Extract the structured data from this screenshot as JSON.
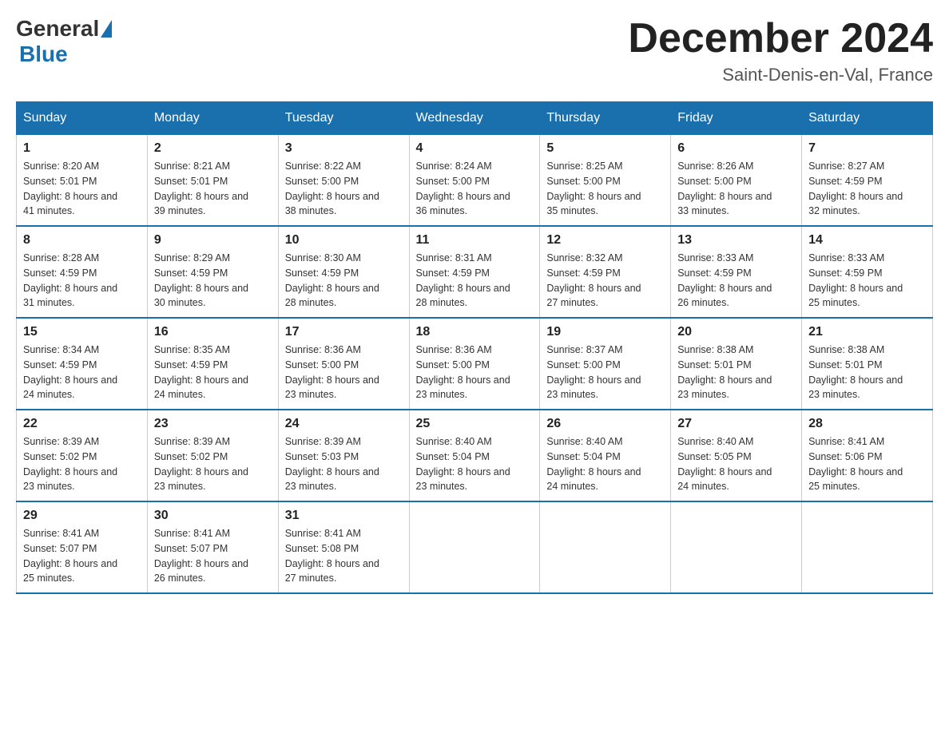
{
  "header": {
    "logo": {
      "text1": "General",
      "text2": "Blue"
    },
    "title": "December 2024",
    "location": "Saint-Denis-en-Val, France"
  },
  "days_of_week": [
    "Sunday",
    "Monday",
    "Tuesday",
    "Wednesday",
    "Thursday",
    "Friday",
    "Saturday"
  ],
  "weeks": [
    [
      {
        "day": "1",
        "sunrise": "8:20 AM",
        "sunset": "5:01 PM",
        "daylight": "8 hours and 41 minutes."
      },
      {
        "day": "2",
        "sunrise": "8:21 AM",
        "sunset": "5:01 PM",
        "daylight": "8 hours and 39 minutes."
      },
      {
        "day": "3",
        "sunrise": "8:22 AM",
        "sunset": "5:00 PM",
        "daylight": "8 hours and 38 minutes."
      },
      {
        "day": "4",
        "sunrise": "8:24 AM",
        "sunset": "5:00 PM",
        "daylight": "8 hours and 36 minutes."
      },
      {
        "day": "5",
        "sunrise": "8:25 AM",
        "sunset": "5:00 PM",
        "daylight": "8 hours and 35 minutes."
      },
      {
        "day": "6",
        "sunrise": "8:26 AM",
        "sunset": "5:00 PM",
        "daylight": "8 hours and 33 minutes."
      },
      {
        "day": "7",
        "sunrise": "8:27 AM",
        "sunset": "4:59 PM",
        "daylight": "8 hours and 32 minutes."
      }
    ],
    [
      {
        "day": "8",
        "sunrise": "8:28 AM",
        "sunset": "4:59 PM",
        "daylight": "8 hours and 31 minutes."
      },
      {
        "day": "9",
        "sunrise": "8:29 AM",
        "sunset": "4:59 PM",
        "daylight": "8 hours and 30 minutes."
      },
      {
        "day": "10",
        "sunrise": "8:30 AM",
        "sunset": "4:59 PM",
        "daylight": "8 hours and 28 minutes."
      },
      {
        "day": "11",
        "sunrise": "8:31 AM",
        "sunset": "4:59 PM",
        "daylight": "8 hours and 28 minutes."
      },
      {
        "day": "12",
        "sunrise": "8:32 AM",
        "sunset": "4:59 PM",
        "daylight": "8 hours and 27 minutes."
      },
      {
        "day": "13",
        "sunrise": "8:33 AM",
        "sunset": "4:59 PM",
        "daylight": "8 hours and 26 minutes."
      },
      {
        "day": "14",
        "sunrise": "8:33 AM",
        "sunset": "4:59 PM",
        "daylight": "8 hours and 25 minutes."
      }
    ],
    [
      {
        "day": "15",
        "sunrise": "8:34 AM",
        "sunset": "4:59 PM",
        "daylight": "8 hours and 24 minutes."
      },
      {
        "day": "16",
        "sunrise": "8:35 AM",
        "sunset": "4:59 PM",
        "daylight": "8 hours and 24 minutes."
      },
      {
        "day": "17",
        "sunrise": "8:36 AM",
        "sunset": "5:00 PM",
        "daylight": "8 hours and 23 minutes."
      },
      {
        "day": "18",
        "sunrise": "8:36 AM",
        "sunset": "5:00 PM",
        "daylight": "8 hours and 23 minutes."
      },
      {
        "day": "19",
        "sunrise": "8:37 AM",
        "sunset": "5:00 PM",
        "daylight": "8 hours and 23 minutes."
      },
      {
        "day": "20",
        "sunrise": "8:38 AM",
        "sunset": "5:01 PM",
        "daylight": "8 hours and 23 minutes."
      },
      {
        "day": "21",
        "sunrise": "8:38 AM",
        "sunset": "5:01 PM",
        "daylight": "8 hours and 23 minutes."
      }
    ],
    [
      {
        "day": "22",
        "sunrise": "8:39 AM",
        "sunset": "5:02 PM",
        "daylight": "8 hours and 23 minutes."
      },
      {
        "day": "23",
        "sunrise": "8:39 AM",
        "sunset": "5:02 PM",
        "daylight": "8 hours and 23 minutes."
      },
      {
        "day": "24",
        "sunrise": "8:39 AM",
        "sunset": "5:03 PM",
        "daylight": "8 hours and 23 minutes."
      },
      {
        "day": "25",
        "sunrise": "8:40 AM",
        "sunset": "5:04 PM",
        "daylight": "8 hours and 23 minutes."
      },
      {
        "day": "26",
        "sunrise": "8:40 AM",
        "sunset": "5:04 PM",
        "daylight": "8 hours and 24 minutes."
      },
      {
        "day": "27",
        "sunrise": "8:40 AM",
        "sunset": "5:05 PM",
        "daylight": "8 hours and 24 minutes."
      },
      {
        "day": "28",
        "sunrise": "8:41 AM",
        "sunset": "5:06 PM",
        "daylight": "8 hours and 25 minutes."
      }
    ],
    [
      {
        "day": "29",
        "sunrise": "8:41 AM",
        "sunset": "5:07 PM",
        "daylight": "8 hours and 25 minutes."
      },
      {
        "day": "30",
        "sunrise": "8:41 AM",
        "sunset": "5:07 PM",
        "daylight": "8 hours and 26 minutes."
      },
      {
        "day": "31",
        "sunrise": "8:41 AM",
        "sunset": "5:08 PM",
        "daylight": "8 hours and 27 minutes."
      },
      {
        "day": "",
        "sunrise": "",
        "sunset": "",
        "daylight": ""
      },
      {
        "day": "",
        "sunrise": "",
        "sunset": "",
        "daylight": ""
      },
      {
        "day": "",
        "sunrise": "",
        "sunset": "",
        "daylight": ""
      },
      {
        "day": "",
        "sunrise": "",
        "sunset": "",
        "daylight": ""
      }
    ]
  ]
}
